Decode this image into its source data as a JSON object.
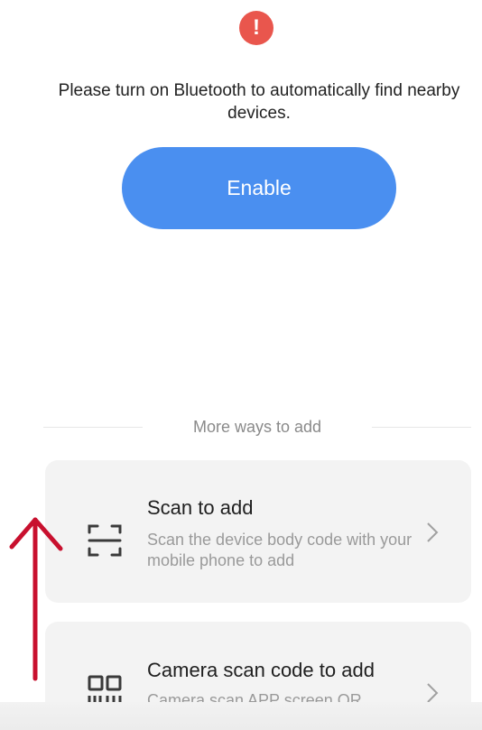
{
  "alert": {
    "icon": "exclamation-icon",
    "color": "#e9564d",
    "glyph": "!"
  },
  "message": "Please turn on Bluetooth to automatically find nearby devices.",
  "enable_button": {
    "label": "Enable",
    "color": "#4a8ff0"
  },
  "more_ways": {
    "label": "More ways to add"
  },
  "options": [
    {
      "title": "Scan to add",
      "description": "Scan the device body code with your mobile phone to add",
      "icon": "scan-frame-icon"
    },
    {
      "title": "Camera scan code to add",
      "description": "Camera scan APP screen QR",
      "icon": "qr-code-icon"
    }
  ],
  "annotation": {
    "icon": "up-arrow-icon",
    "color": "#c8102e"
  }
}
